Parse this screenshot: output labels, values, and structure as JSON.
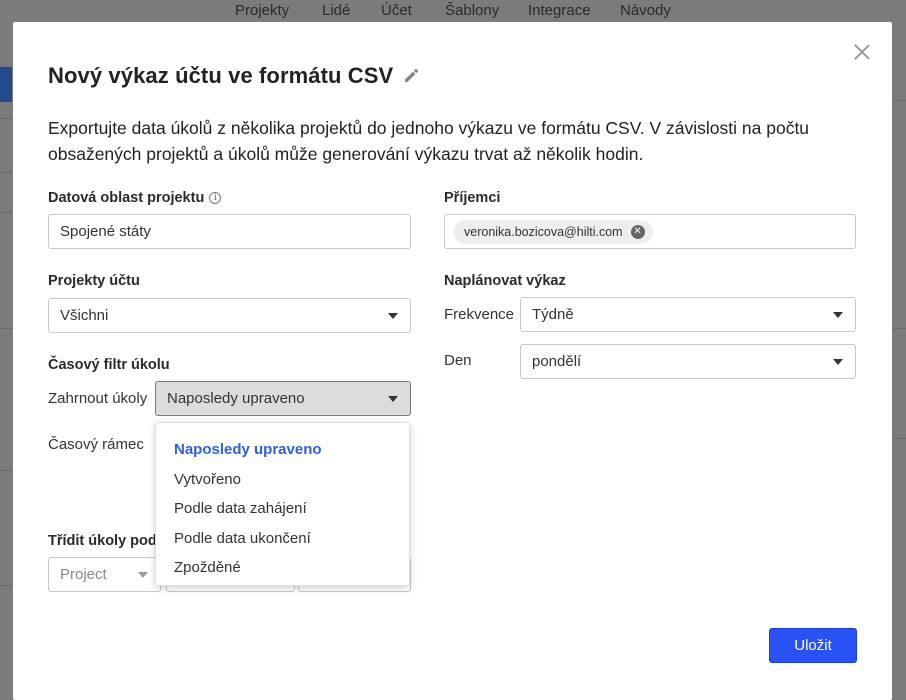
{
  "background": {
    "nav_items": [
      "Projekty",
      "Lidé",
      "Účet",
      "Šablony",
      "Integrace",
      "Návody"
    ]
  },
  "modal": {
    "title": "Nový výkaz účtu ve formátu CSV",
    "description": "Exportujte data úkolů z několika projektů do jednoho výkazu ve formátu CSV. V závislosti na počtu obsažených projektů a úkolů může generování výkazu trvat až několik hodin.",
    "data_region": {
      "label": "Datová oblast projektu",
      "value": "Spojené státy"
    },
    "recipients": {
      "label": "Příjemci",
      "chips": [
        "veronika.bozicova@hilti.com"
      ]
    },
    "account_projects": {
      "label": "Projekty účtu",
      "value": "Všichni"
    },
    "schedule": {
      "label": "Naplánovat výkaz",
      "frequency_label": "Frekvence",
      "frequency_value": "Týdně",
      "day_label": "Den",
      "day_value": "pondělí"
    },
    "time_filter": {
      "label": "Časový filtr úkolu",
      "include_label": "Zahrnout úkoly",
      "include_value": "Naposledy upraveno",
      "timeframe_label": "Časový rámec",
      "options": [
        "Naposledy upraveno",
        "Vytvořeno",
        "Podle data zahájení",
        "Podle data ukončení",
        "Zpožděné"
      ],
      "selected_option": "Naposledy upraveno"
    },
    "sort": {
      "label": "Třídit úkoly podle",
      "value": "Project"
    },
    "save_label": "Uložit"
  }
}
